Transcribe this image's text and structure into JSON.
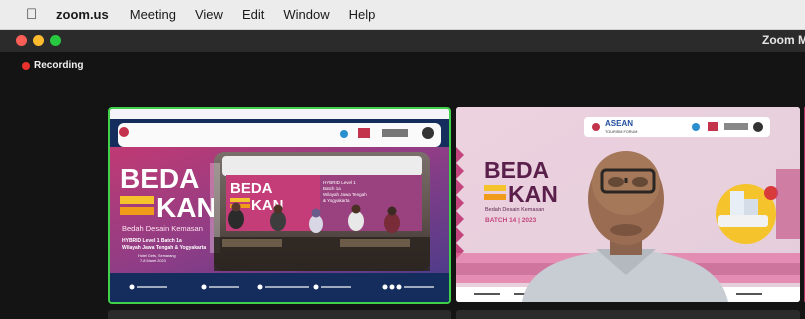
{
  "menubar": {
    "app_name": "zoom.us",
    "items": [
      "Meeting",
      "View",
      "Edit",
      "Window",
      "Help"
    ]
  },
  "window": {
    "title": "Zoom M",
    "traffic_lights": [
      "#fd5f56",
      "#febb2e",
      "#28c840"
    ]
  },
  "recording": {
    "label": "Recording",
    "color": "#e8322b"
  },
  "speaker_tile": {
    "active_border_color": "#3fd149",
    "banner": {
      "big_word_top": "BEDA",
      "big_word_bottom": "KAN",
      "subtitle": "Bedah Desain Kemasan",
      "event": "HYBRID Level 1 Batch 1a",
      "region": "Wilayah Jawa Tengah & Yogyakarta",
      "venue": "Hotel Gets, Semarang",
      "date": "7-8 Maret 2023"
    },
    "inner_photo": {
      "big_word_top": "BEDA",
      "big_word_bottom": "KAN",
      "line1": "HYBRID Level 1",
      "line2": "Batch 1a",
      "line3": "Wilayah Jawa Tengah",
      "line4": "& Yogyakarta"
    }
  },
  "camera_tile": {
    "logo_text": "ASEAN",
    "logo_sub": "TOURISM FORUM",
    "big_word_top": "BEDA",
    "big_word_bottom": "KAN",
    "subtitle": "Bedah Desain Kemasan",
    "batch": "BATCH 14 | 2023"
  },
  "colors": {
    "banner_purple": "#b22c65",
    "banner_orange": "#f19b1b",
    "banner_yellow": "#f5c42c",
    "navy": "#142d5c"
  }
}
